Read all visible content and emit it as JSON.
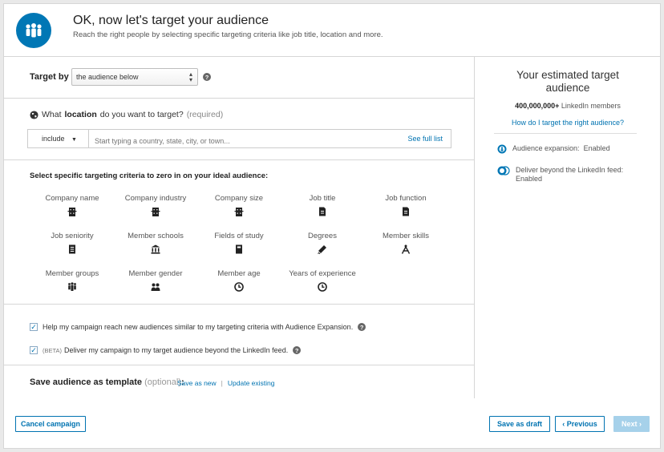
{
  "header": {
    "title": "OK, now let's target your audience",
    "subtitle": "Reach the right people by selecting specific targeting criteria like job title, location and more.",
    "logo_icon": "audience-people-icon"
  },
  "target_by": {
    "label": "Target by",
    "selected": "the audience below",
    "help": "?"
  },
  "location": {
    "prefix": "What",
    "keyword": "location",
    "suffix": "do you want to target?",
    "required": "(required)",
    "include": "include",
    "placeholder": "Start typing a country, state, city, or town...",
    "see_full_list": "See full list"
  },
  "criteria": {
    "title": "Select specific targeting criteria to zero in on your ideal audience:",
    "items": [
      {
        "label": "Company name",
        "icon": "building-icon"
      },
      {
        "label": "Company industry",
        "icon": "building-icon"
      },
      {
        "label": "Company size",
        "icon": "building-icon"
      },
      {
        "label": "Job title",
        "icon": "document-icon"
      },
      {
        "label": "Job function",
        "icon": "document-icon"
      },
      {
        "label": "Job seniority",
        "icon": "badge-icon"
      },
      {
        "label": "Member schools",
        "icon": "school-icon"
      },
      {
        "label": "Fields of study",
        "icon": "book-icon"
      },
      {
        "label": "Degrees",
        "icon": "diploma-icon"
      },
      {
        "label": "Member skills",
        "icon": "compass-icon"
      },
      {
        "label": "Member groups",
        "icon": "group-icon"
      },
      {
        "label": "Member gender",
        "icon": "gender-icon"
      },
      {
        "label": "Member age",
        "icon": "clock-icon"
      },
      {
        "label": "Years of experience",
        "icon": "clock-icon"
      }
    ]
  },
  "checks": {
    "expansion": "Help my campaign reach new audiences similar to my targeting criteria with Audience Expansion.",
    "beta_tag": "(BETA)",
    "beyond": "Deliver my campaign to my target audience beyond the LinkedIn feed."
  },
  "template": {
    "label": "Save audience as template",
    "optional": "(optional)",
    "colon": ":",
    "save_new": "Save as new",
    "update": "Update existing"
  },
  "sidebar": {
    "estimate_title": "Your estimated target audience",
    "members_count": "400,000,000+",
    "members_suffix": "LinkedIn members",
    "how_link": "How do I target the right audience?",
    "expansion": "Audience expansion:  Enabled",
    "beyond": "Deliver beyond the LinkedIn feed:  Enabled"
  },
  "footer": {
    "cancel": "Cancel campaign",
    "save_draft": "Save as draft",
    "previous": "‹ Previous",
    "next": "Next ›"
  },
  "colors": {
    "brand": "#0077b5",
    "link": "#0073b1",
    "next_disabled": "#a6d1ea"
  }
}
